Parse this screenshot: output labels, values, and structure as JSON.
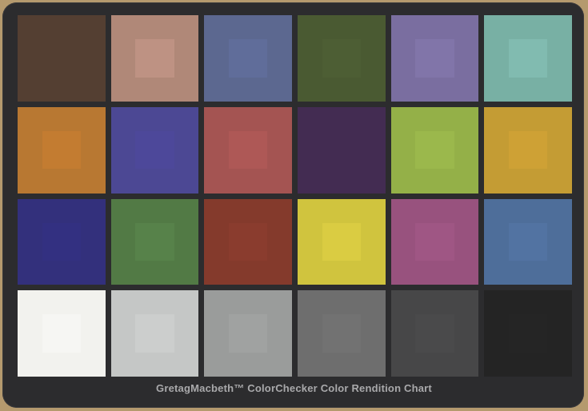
{
  "caption": "GretagMacbeth™ ColorChecker Color Rendition Chart",
  "colors": {
    "background": "#b59a6e",
    "board": "#2c2c2e"
  },
  "patches": [
    {
      "color": "#543f32",
      "inner": "#4f3c30"
    },
    {
      "color": "#b08878",
      "inner": "#c99a8e"
    },
    {
      "color": "#5c6890",
      "inner": "#6070a0"
    },
    {
      "color": "#4a5a32",
      "inner": "#4f6035"
    },
    {
      "color": "#7a6ea0",
      "inner": "#8478ad"
    },
    {
      "color": "#78b0a4",
      "inner": "#88c2b8"
    },
    {
      "color": "#b87832",
      "inner": "#c87c2c"
    },
    {
      "color": "#4c4894",
      "inner": "#4a449a"
    },
    {
      "color": "#a45452",
      "inner": "#b45a58"
    },
    {
      "color": "#432c52",
      "inner": "#3e2a4e"
    },
    {
      "color": "#94b048",
      "inner": "#9cb850"
    },
    {
      "color": "#c49c34",
      "inner": "#d0a034"
    },
    {
      "color": "#33307c",
      "inner": "#302c82"
    },
    {
      "color": "#527a45",
      "inner": "#5a8650"
    },
    {
      "color": "#843a2c",
      "inner": "#8c3c30"
    },
    {
      "color": "#d0c43e",
      "inner": "#dccc46"
    },
    {
      "color": "#98527e",
      "inner": "#a05886"
    },
    {
      "color": "#4e6e9a",
      "inner": "#5474a6"
    },
    {
      "color": "#f2f2ee",
      "inner": "#ffffff"
    },
    {
      "color": "#c5c7c6",
      "inner": "#cacccb"
    },
    {
      "color": "#9a9c9b",
      "inner": "#a0a2a1"
    },
    {
      "color": "#6e6e6e",
      "inner": "#727272"
    },
    {
      "color": "#474748",
      "inner": "#4a4a4b"
    },
    {
      "color": "#242424",
      "inner": "#262626"
    }
  ]
}
